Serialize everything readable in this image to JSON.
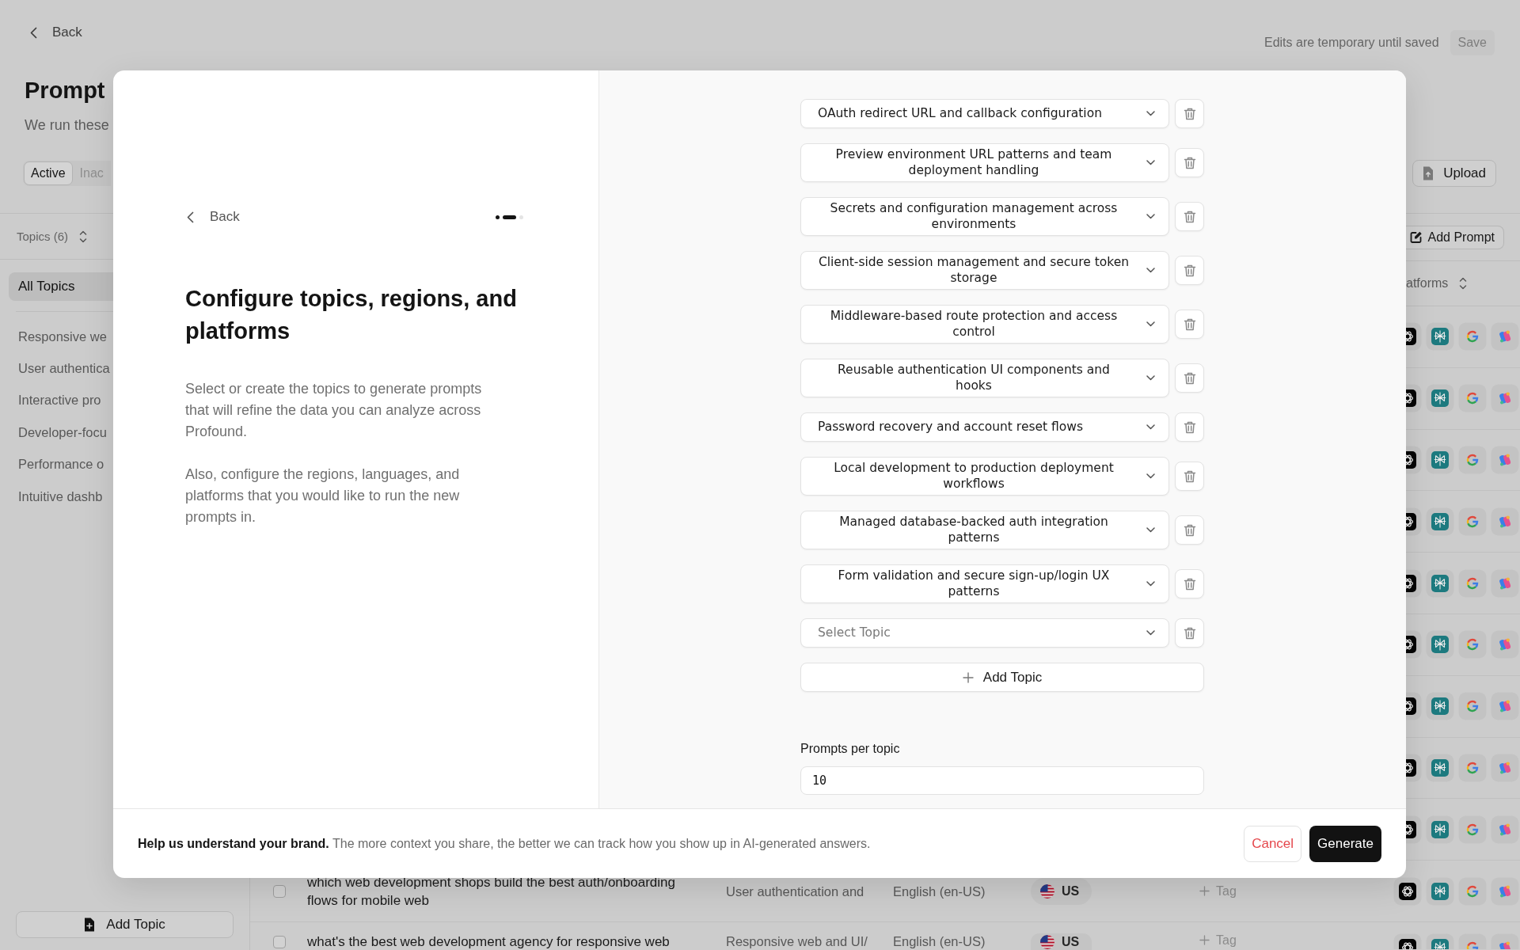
{
  "header": {
    "back_link": "Back",
    "save_hint": "Edits are temporary until saved",
    "save_button": {
      "label": "Save",
      "disabled": true
    },
    "title": "Prompt",
    "subtitle": "We run these",
    "tabs": [
      {
        "label": "Active",
        "selected": true
      },
      {
        "label": "Inac",
        "selected": false
      }
    ],
    "upload_button": "Upload"
  },
  "sidebar": {
    "sort_label": "Topics (6)",
    "items": [
      {
        "kind": "all",
        "label": "All Topics",
        "selected": true
      },
      {
        "kind": "topic",
        "label": "Responsive we",
        "selected": false
      },
      {
        "kind": "topic",
        "label": "User authentica",
        "selected": false
      },
      {
        "kind": "topic",
        "label": "Interactive pro",
        "selected": false
      },
      {
        "kind": "topic",
        "label": "Developer-focu",
        "selected": false
      },
      {
        "kind": "topic",
        "label": "Performance o",
        "selected": false
      },
      {
        "kind": "topic",
        "label": "Intuitive dashb",
        "selected": false
      }
    ],
    "add_button": "Add Topic"
  },
  "table": {
    "add_prompt_button": "Add Prompt",
    "column_header": "atforms",
    "rows": [
      {
        "kind": "covered"
      },
      {
        "kind": "covered"
      },
      {
        "kind": "covered"
      },
      {
        "kind": "covered"
      },
      {
        "kind": "covered"
      },
      {
        "kind": "covered"
      },
      {
        "kind": "covered"
      },
      {
        "kind": "covered"
      },
      {
        "kind": "covered"
      },
      {
        "kind": "full",
        "checked": false,
        "prompt": "which web development shops build the best auth/onboarding flows for mobile web",
        "topic": "User authentication and",
        "language": "English (en-US)",
        "region": "US",
        "tag": "Tag"
      },
      {
        "kind": "partial",
        "checked": false,
        "prompt": "what's the best web development agency for responsive web",
        "topic": "Responsive web and UI/",
        "language": "English (en-US)",
        "region": "US",
        "tag": "Tag"
      }
    ]
  },
  "modal": {
    "back_link": "Back",
    "steps": [
      {
        "selected": false
      },
      {
        "selected": true
      },
      {
        "selected": false
      }
    ],
    "title": "Configure topics, regions, and platforms",
    "paragraphs": [
      "Select or create the topics to generate prompts that will refine the data you can analyze across Profound.",
      "Also, configure the regions, languages, and platforms that you would like to run the new prompts in."
    ],
    "topics": [
      {
        "value": "OAuth redirect URL and callback configuration"
      },
      {
        "value": "Preview environment URL patterns and team deployment handling"
      },
      {
        "value": "Secrets and configuration management across environments"
      },
      {
        "value": "Client-side session management and secure token storage"
      },
      {
        "value": "Middleware-based route protection and access control"
      },
      {
        "value": "Reusable authentication UI components and hooks"
      },
      {
        "value": "Password recovery and account reset flows"
      },
      {
        "value": "Local development to production deployment workflows"
      },
      {
        "value": "Managed database-backed auth integration patterns"
      },
      {
        "value": "Form validation and secure sign-up/login UX patterns"
      },
      {
        "placeholder": "Select Topic"
      }
    ],
    "add_topic_button": "Add Topic",
    "prompts_per_topic": {
      "label": "Prompts per topic",
      "value": "10"
    },
    "footer_note": "**Help us understand your brand.** The more context you share, the better we can track how you show up in AI-generated answers.",
    "cancel_button": "Cancel",
    "generate_button": "Generate"
  }
}
